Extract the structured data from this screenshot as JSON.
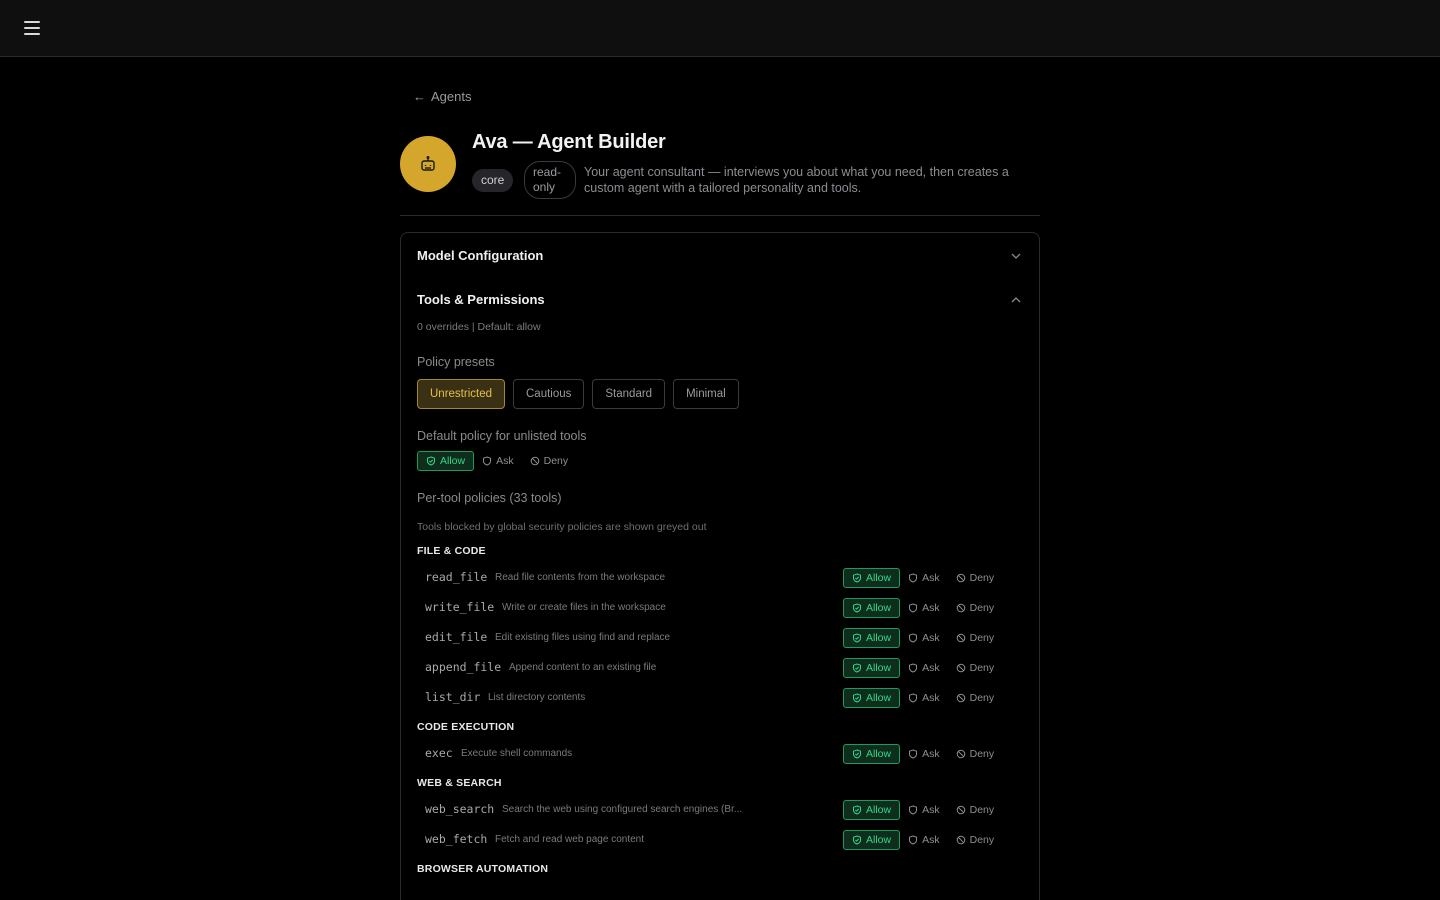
{
  "header": {
    "menu_icon": "hamburger-menu-icon"
  },
  "back": {
    "label": "Agents"
  },
  "agent": {
    "name": "Ava — Agent Builder",
    "avatar_icon": "robot-icon",
    "avatar_color": "#d4a72c",
    "tags": [
      "core",
      "read-only"
    ],
    "description": "Your agent consultant — interviews you about what you need, then creates a custom agent with a tailored personality and tools."
  },
  "sections": {
    "model": {
      "title": "Model Configuration"
    },
    "tools": {
      "title": "Tools & Permissions",
      "summary": "0 overrides | Default: allow",
      "presets_label": "Policy presets",
      "presets": [
        "Unrestricted",
        "Cautious",
        "Standard",
        "Minimal"
      ],
      "active_preset": "Unrestricted",
      "default_label": "Default policy for unlisted tools",
      "policy_options": {
        "allow": "Allow",
        "ask": "Ask",
        "deny": "Deny"
      },
      "default_policy": "allow",
      "per_tool_label": "Per-tool policies (33 tools)",
      "blocked_note": "Tools blocked by global security policies are shown greyed out",
      "categories": [
        {
          "name": "FILE & CODE",
          "tools": [
            {
              "name": "read_file",
              "desc": "Read file contents from the workspace",
              "policy": "allow"
            },
            {
              "name": "write_file",
              "desc": "Write or create files in the workspace",
              "policy": "allow"
            },
            {
              "name": "edit_file",
              "desc": "Edit existing files using find and replace",
              "policy": "allow"
            },
            {
              "name": "append_file",
              "desc": "Append content to an existing file",
              "policy": "allow"
            },
            {
              "name": "list_dir",
              "desc": "List directory contents",
              "policy": "allow"
            }
          ]
        },
        {
          "name": "CODE EXECUTION",
          "tools": [
            {
              "name": "exec",
              "desc": "Execute shell commands",
              "policy": "allow"
            }
          ]
        },
        {
          "name": "WEB & SEARCH",
          "tools": [
            {
              "name": "web_search",
              "desc": "Search the web using configured search engines (Br...",
              "policy": "allow"
            },
            {
              "name": "web_fetch",
              "desc": "Fetch and read web page content",
              "policy": "allow"
            }
          ]
        },
        {
          "name": "BROWSER AUTOMATION",
          "tools": []
        }
      ]
    }
  },
  "colors": {
    "allow_text": "#2fd98a",
    "allow_bg": "#0f2d1d",
    "preset_active": "#e5c04a"
  }
}
